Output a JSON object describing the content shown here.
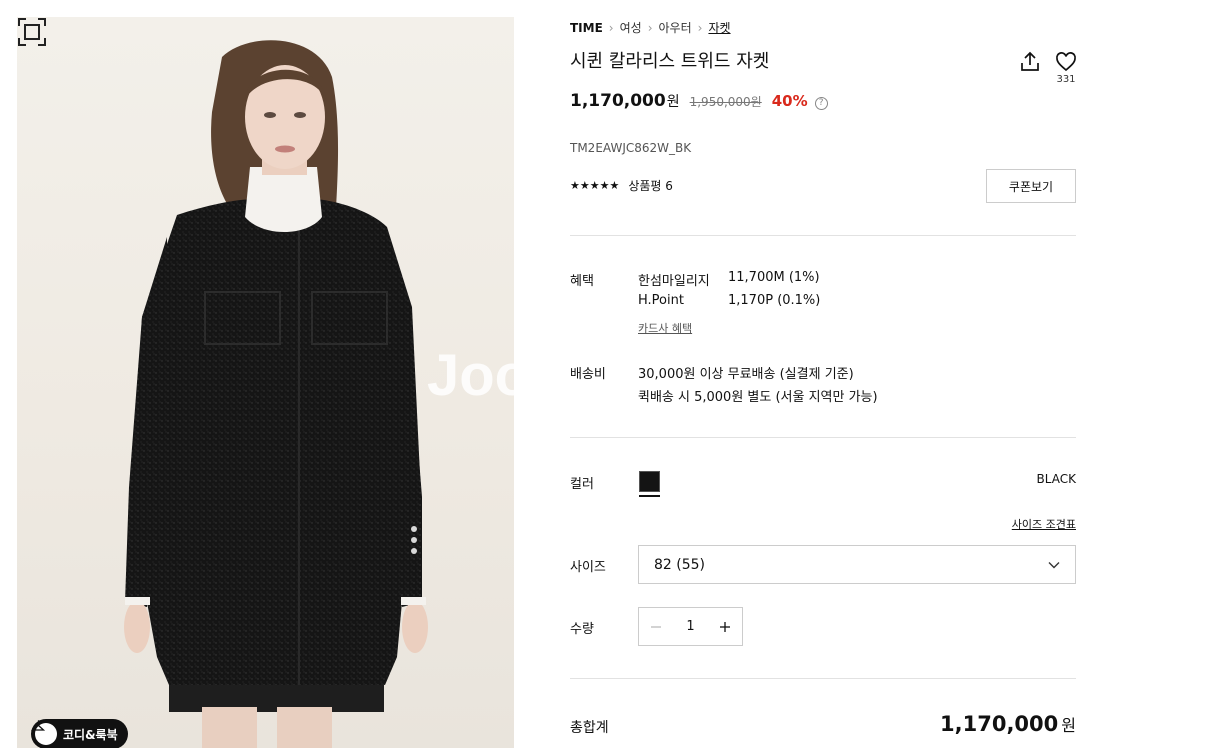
{
  "gallery": {
    "watermark": "Joo",
    "coordi_label": "코디&룩북"
  },
  "breadcrumb": {
    "brand": "TIME",
    "items": [
      "여성",
      "아우터",
      "자켓"
    ]
  },
  "product": {
    "title": "시퀸 칼라리스 트위드 자켓",
    "like_count": "331",
    "price": "1,170,000",
    "price_unit": "원",
    "original_price": "1,950,000원",
    "discount": "40%",
    "discount_help": "?",
    "code": "TM2EAWJC862W_BK",
    "stars": "★★★★★",
    "rating": 4.5,
    "review_label": "상품평 6",
    "coupon_label": "쿠폰보기"
  },
  "benefits": {
    "label": "혜택",
    "rows": [
      {
        "name": "한섬마일리지",
        "value": "11,700M (1%)"
      },
      {
        "name": "H.Point",
        "value": "1,170P (0.1%)"
      }
    ],
    "card_link": "카드사 혜택"
  },
  "shipping": {
    "label": "배송비",
    "line1": "30,000원 이상 무료배송 (실결제 기준)",
    "line2": "퀵배송 시 5,000원 별도 (서울 지역만 가능)"
  },
  "color": {
    "label": "컬러",
    "selected": "BLACK",
    "swatch_hex": "#141414"
  },
  "size": {
    "guide_link": "사이즈 조견표",
    "label": "사이즈",
    "selected": "82 (55)"
  },
  "quantity": {
    "label": "수량",
    "value": "1"
  },
  "total": {
    "label": "총합계",
    "amount": "1,170,000",
    "unit": "원"
  },
  "colors": {
    "discount_red": "#d9291c",
    "jacket": "#151515"
  }
}
